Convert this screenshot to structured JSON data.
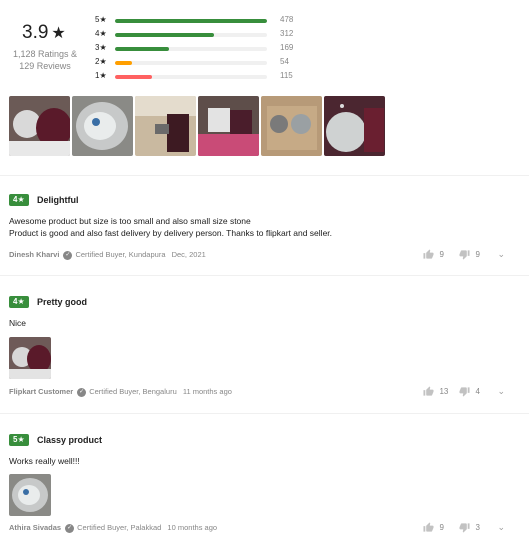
{
  "summary": {
    "average": "3.9",
    "star_glyph": "★",
    "ratings_text": "1,128 Ratings &",
    "reviews_text": "129 Reviews",
    "distribution": [
      {
        "label": "5★",
        "count": "478",
        "fraction": 1.0,
        "color": "#388e3c"
      },
      {
        "label": "4★",
        "count": "312",
        "fraction": 0.653,
        "color": "#388e3c"
      },
      {
        "label": "3★",
        "count": "169",
        "fraction": 0.354,
        "color": "#388e3c"
      },
      {
        "label": "2★",
        "count": "54",
        "fraction": 0.113,
        "color": "#ff9f00"
      },
      {
        "label": "1★",
        "count": "115",
        "fraction": 0.241,
        "color": "#ff6161"
      }
    ],
    "thumbnails": [
      "product-photo-1",
      "product-photo-2",
      "product-photo-3",
      "product-photo-4",
      "product-photo-5",
      "product-photo-6"
    ]
  },
  "reviews": [
    {
      "rating": "4★",
      "title": "Delightful",
      "body_lines": [
        "Awesome product but size is too small and also small size stone",
        "Product is good and also fast delivery by delivery person. Thanks to flipkart and seller."
      ],
      "author": "Dinesh Kharvi",
      "certified": "Certified Buyer, Kundapura",
      "date": "Dec, 2021",
      "likes": "9",
      "dislikes": "9"
    },
    {
      "rating": "4★",
      "title": "Pretty good",
      "body_lines": [
        "Nice"
      ],
      "author": "Flipkart Customer",
      "certified": "Certified Buyer, Bengaluru",
      "date": "11 months ago",
      "likes": "13",
      "dislikes": "4"
    },
    {
      "rating": "5★",
      "title": "Classy product",
      "body_lines": [
        "Works really well!!!"
      ],
      "author": "Athira Sivadas",
      "certified": "Certified Buyer, Palakkad",
      "date": "10 months ago",
      "likes": "9",
      "dislikes": "3"
    }
  ],
  "colors": {
    "rating_green": "#388e3c",
    "muted_text": "#878787"
  }
}
